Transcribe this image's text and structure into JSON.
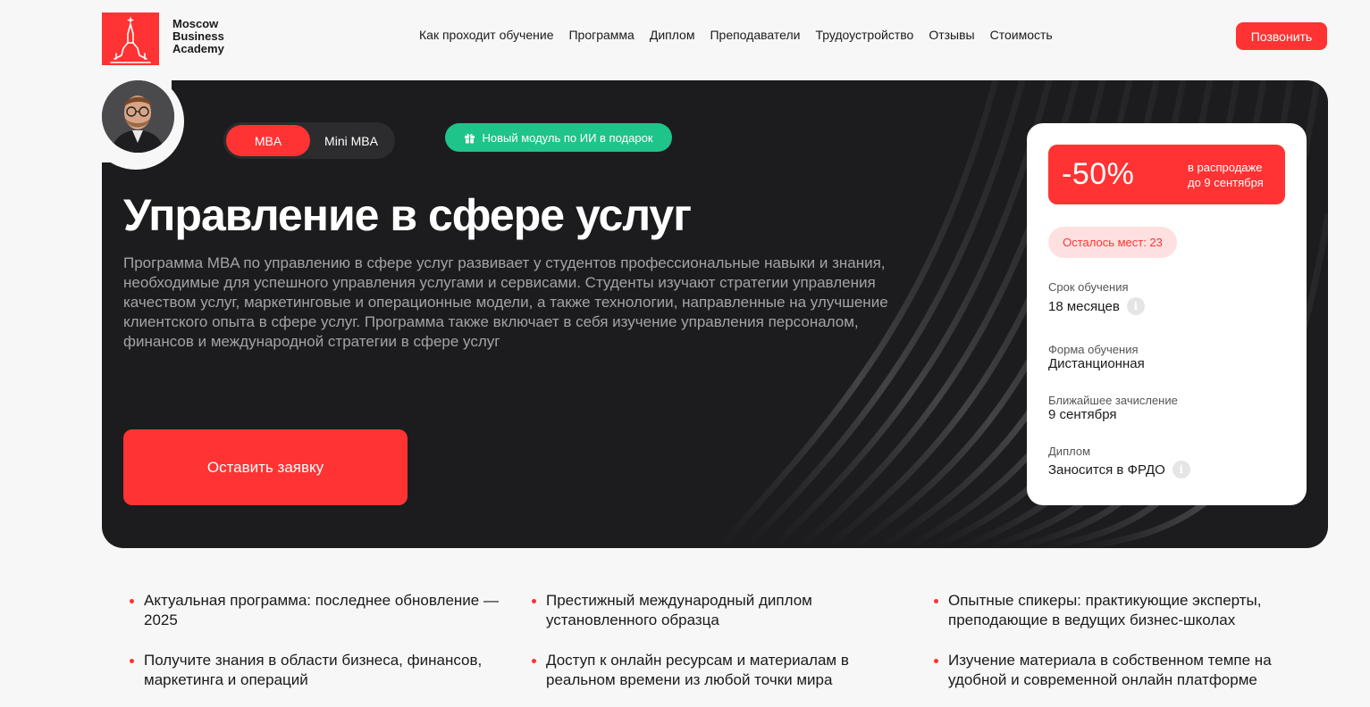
{
  "header": {
    "logo_lines": [
      "Moscow",
      "Business",
      "Academy"
    ],
    "nav": [
      "Как проходит обучение",
      "Программа",
      "Диплом",
      "Преподаватели",
      "Трудоустройство",
      "Отзывы",
      "Стоимость"
    ],
    "call_label": "Позвонить"
  },
  "hero": {
    "tabs": {
      "active": "MBA",
      "inactive": "Mini MBA"
    },
    "gift_badge": "Новый модуль по ИИ в подарок",
    "title": "Управление в сфере услуг",
    "description": "Программа MBA по управлению в сфере услуг развивает у студентов профессиональные навыки и знания, необходимые для успешного управления услугами и сервисами. Студенты изучают стратегии управления качеством услуг, маркетинговые и операционные модели, а также технологии, направленные на улучшение клиентского опыта в сфере услуг. Программа также включает в себя изучение управления персоналом, финансов и международной стратегии в сфере услуг",
    "apply_label": "Оставить заявку"
  },
  "card": {
    "discount": "-50%",
    "sale_note_line1": "в распродаже",
    "sale_note_line2": "до 9 сентября",
    "seats": "Осталось мест: 23",
    "facts": [
      {
        "label": "Срок обучения",
        "value": "18 месяцев"
      },
      {
        "label": "Форма обучения",
        "value": "Дистанционная"
      },
      {
        "label": "Ближайшее зачисление",
        "value": "9 сентября"
      },
      {
        "label": "Диплом",
        "value": "Заносится в ФРДО"
      }
    ],
    "info_glyph": "i"
  },
  "features": [
    "Актуальная программа: последнее обновление — 2025",
    "Престижный международный диплом установленного образца",
    "Опытные спикеры: практикующие эксперты, преподающие в ведущих бизнес-школах",
    "Получите знания в области бизнеса, финансов, маркетинга и операций",
    "Доступ к онлайн ресурсам и материалам в реальном времени из любой точки мира",
    "Изучение материала в собственном темпе на удобной и современной онлайн платформе"
  ],
  "colors": {
    "accent": "#ff3333",
    "green": "#1fc48a",
    "dark": "#1c1c1e"
  },
  "icons": [
    "kremlin-logo-icon",
    "gift-icon",
    "info-icon",
    "avatar-photo"
  ]
}
